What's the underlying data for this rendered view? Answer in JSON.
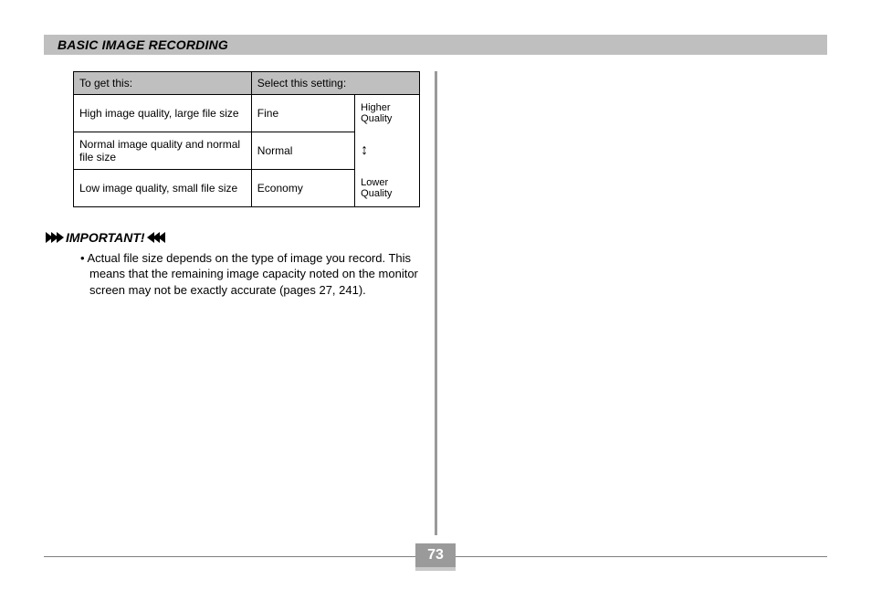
{
  "section_title": "BASIC IMAGE RECORDING",
  "table": {
    "headers": {
      "col1": "To get this:",
      "col2": "Select this setting:"
    },
    "rows": [
      {
        "desc": "High image quality, large file size",
        "setting": "Fine",
        "quality": "Higher Quality"
      },
      {
        "desc": "Normal image quality and normal file size",
        "setting": "Normal",
        "quality": ""
      },
      {
        "desc": "Low image quality, small file size",
        "setting": "Economy",
        "quality": "Lower Quality"
      }
    ]
  },
  "important": {
    "label": "IMPORTANT!",
    "bullet": "•",
    "text": "Actual file size depends on the type of image you record. This means that the remaining image capacity noted on the monitor screen may not be exactly accurate (pages 27, 241)."
  },
  "page_number": "73"
}
